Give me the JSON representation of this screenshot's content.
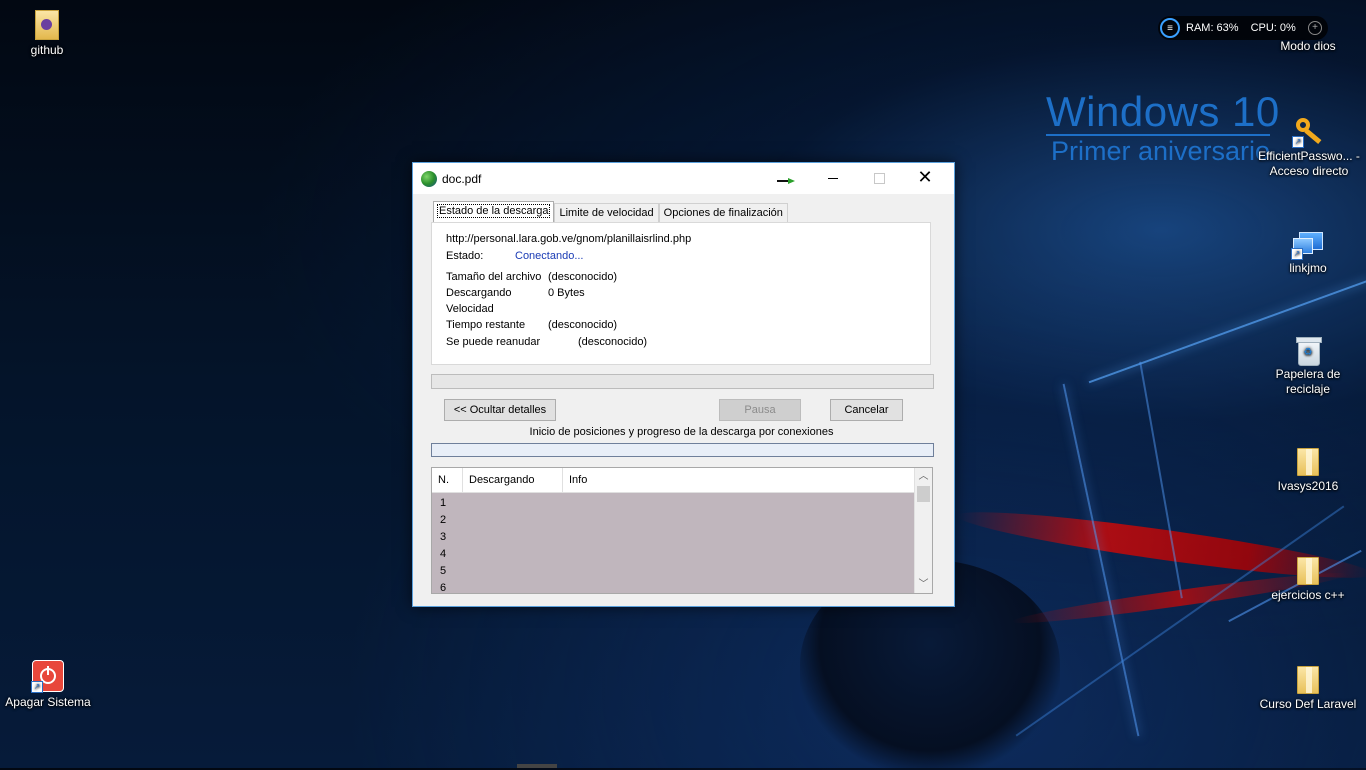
{
  "desktop": {
    "watermark_line1": "Windows 10",
    "watermark_line2": "Primer aniversario",
    "widget": {
      "ram": "RAM: 63%",
      "cpu": "CPU: 0%"
    },
    "icons": [
      {
        "label": "github"
      },
      {
        "label": "Modo dios"
      },
      {
        "label": "EfficientPasswo... - Acceso directo"
      },
      {
        "label": "linkjmo"
      },
      {
        "label": "Papelera de reciclaje"
      },
      {
        "label": "Ivasys2016"
      },
      {
        "label": "ejercicios c++"
      },
      {
        "label": "Curso Def Laravel"
      },
      {
        "label": "Apagar Sistema"
      }
    ]
  },
  "dialog": {
    "title": "doc.pdf",
    "tabs": [
      {
        "label": "Estado de la descarga"
      },
      {
        "label": "Limite de velocidad"
      },
      {
        "label": "Opciones de finalización"
      }
    ],
    "url": "http://personal.lara.gob.ve/gnom/planillaisrlind.php",
    "state_label": "Estado:",
    "state_value": "Conectando...",
    "details": [
      {
        "label": "Tamaño del archivo",
        "value": "(desconocido)"
      },
      {
        "label": "Descargando",
        "value": "0 Bytes"
      },
      {
        "label": "Velocidad",
        "value": ""
      },
      {
        "label": "Tiempo restante",
        "value": "(desconocido)"
      },
      {
        "label": "Se puede reanudar",
        "value": "(desconocido)"
      }
    ],
    "progress_fraction": 0,
    "buttons": {
      "hide_details": "<< Ocultar detalles",
      "pause": "Pausa",
      "cancel": "Cancelar"
    },
    "connections_caption": "Inicio de posiciones y progreso de la descarga por conexiones",
    "table": {
      "columns": [
        "N.",
        "Descargando",
        "Info"
      ],
      "rows": [
        "1",
        "2",
        "3",
        "4",
        "5",
        "6"
      ]
    }
  }
}
